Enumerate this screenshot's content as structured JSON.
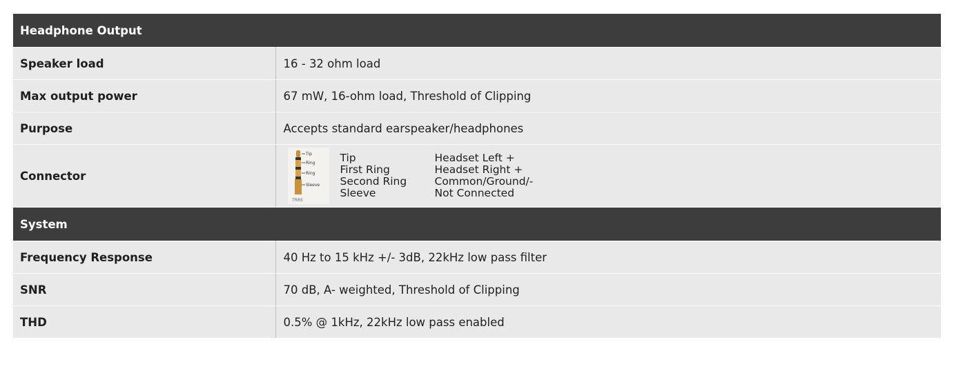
{
  "sections": [
    {
      "title": "Headphone Output",
      "rows": [
        {
          "label": "Speaker load",
          "value": "16 - 32 ohm load"
        },
        {
          "label": "Max output power",
          "value": "67 mW, 16-ohm load, Threshold of Clipping"
        },
        {
          "label": "Purpose",
          "value": "Accepts standard earspeaker/headphones"
        }
      ],
      "connector": {
        "label": "Connector",
        "image_labels": [
          "Tip",
          "Ring",
          "Ring",
          "Sleeve",
          "TRRS"
        ],
        "pins": [
          {
            "name": "Tip",
            "function": "Headset Left +"
          },
          {
            "name": "First Ring",
            "function": "Headset Right +"
          },
          {
            "name": "Second Ring",
            "function": "Common/Ground/-"
          },
          {
            "name": "Sleeve",
            "function": "Not Connected"
          }
        ]
      }
    },
    {
      "title": "System",
      "rows": [
        {
          "label": "Frequency Response",
          "value": "40 Hz to 15 kHz +/- 3dB, 22kHz low pass filter"
        },
        {
          "label": "SNR",
          "value": "70 dB, A- weighted, Threshold of Clipping"
        },
        {
          "label": "THD",
          "value": "0.5% @ 1kHz, 22kHz low pass enabled"
        }
      ]
    }
  ],
  "colors": {
    "header_bg": "#3d3d3d",
    "row_bg": "#e9e9e9",
    "plug_gold": "#c9923a"
  }
}
